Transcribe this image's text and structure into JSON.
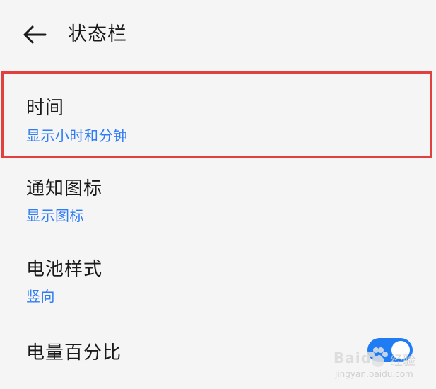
{
  "header": {
    "title": "状态栏",
    "back_icon": "arrow-left-icon"
  },
  "settings": [
    {
      "title": "时间",
      "subtitle": "显示小时和分钟",
      "highlighted": true
    },
    {
      "title": "通知图标",
      "subtitle": "显示图标"
    },
    {
      "title": "电池样式",
      "subtitle": "竖向"
    },
    {
      "title": "电量百分比",
      "toggle_on": true
    }
  ],
  "colors": {
    "background": "#f5f5f5",
    "title_text": "#1a1a1a",
    "subtitle_text": "#2e7cf6",
    "highlight_border": "#e2403f",
    "toggle_on": "#1f7cf2"
  },
  "watermark": {
    "brand": "Baidu",
    "brand_suffix": "经验",
    "url": "jingyan.baidu.com"
  }
}
